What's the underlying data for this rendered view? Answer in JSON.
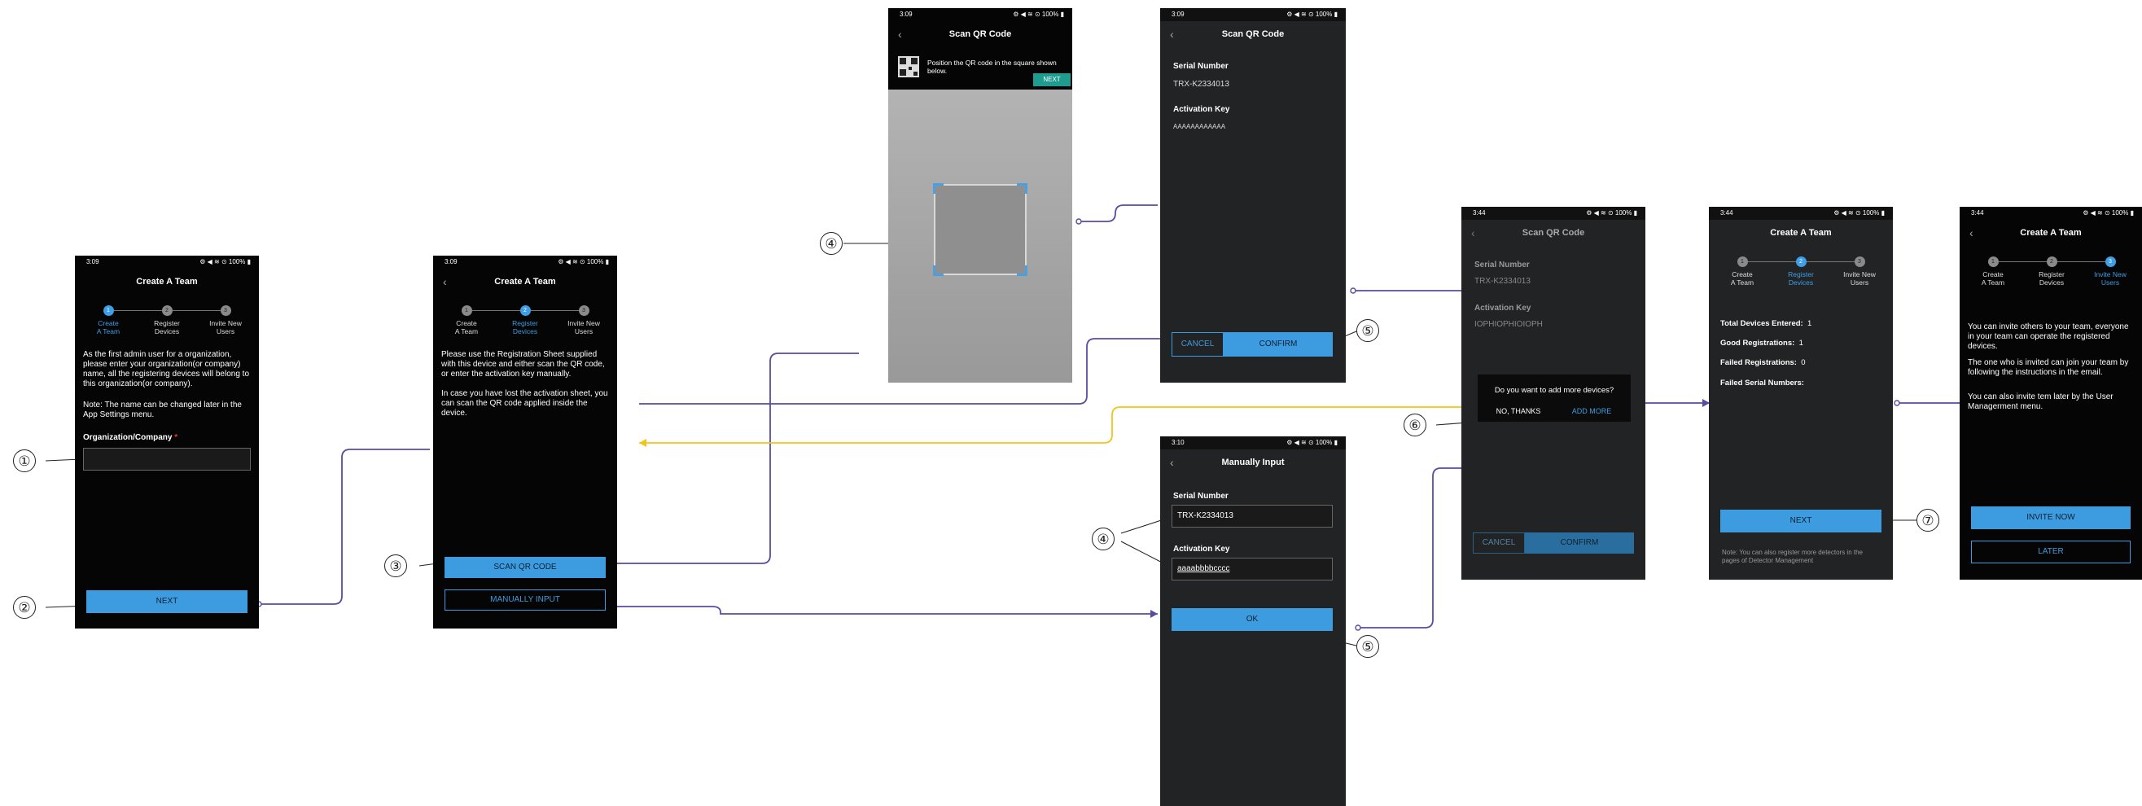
{
  "status_times": {
    "s1": "3:09",
    "s2": "3:09",
    "s3": "3:09",
    "s4": "3:09",
    "s5": "3:10",
    "s6": "3:44",
    "s7": "3:44",
    "s8": "3:44"
  },
  "status_icons": "⚙ ◀ ≋ ⊙ 100% ▮",
  "back_glyph": "‹",
  "stepper": {
    "step1": {
      "num": "1",
      "line1": "Create",
      "line2": "A Team"
    },
    "step2": {
      "num": "2",
      "line1": "Register",
      "line2": "Devices"
    },
    "step3": {
      "num": "3",
      "line1": "Invite New",
      "line2": "Users"
    }
  },
  "create_team": {
    "title": "Create A Team",
    "desc": "As the first admin user for a organization, please enter your organization(or company) name, all the registering devices will belong to this organization(or company).",
    "note": "Note: The name can be changed later in the App Settings menu.",
    "field_label": "Organization/Company",
    "required_mark": "*",
    "next": "NEXT"
  },
  "register_devices": {
    "title": "Create A Team",
    "desc1": "Please use the Registration Sheet supplied with this device and either scan the QR code, or enter the activation key manually.",
    "desc2": "In case you have lost the activation sheet, you can scan the QR code applied inside the device.",
    "scan": "SCAN QR CODE",
    "manual": "MANUALLY INPUT"
  },
  "scan_camera": {
    "title": "Scan QR Code",
    "hint": "Position the QR code in the square shown below.",
    "next": "NEXT"
  },
  "scan_result": {
    "title": "Scan QR Code",
    "serial_label": "Serial Number",
    "serial": "TRX-K2334013",
    "key_label": "Activation Key",
    "key": "AAAAAAAAAAAA",
    "cancel": "CANCEL",
    "confirm": "CONFIRM"
  },
  "manual_input": {
    "title": "Manually Input",
    "serial_label": "Serial Number",
    "serial": "TRX-K2334013",
    "key_label": "Activation Key",
    "key": "aaaabbbbcccc",
    "ok": "OK"
  },
  "add_more": {
    "title": "Scan QR Code",
    "serial_label": "Serial Number",
    "serial": "TRX-K2334013",
    "key_label": "Activation Key",
    "key": "IOPHIOPHIOIOPH",
    "question": "Do you want to add more devices?",
    "no": "NO, THANKS",
    "add": "ADD MORE",
    "cancel": "CANCEL",
    "confirm": "CONFIRM"
  },
  "summary": {
    "title": "Create A Team",
    "total_label": "Total Devices Entered:",
    "total": "1",
    "good_label": "Good Registrations:",
    "good": "1",
    "failed_label": "Failed Registrations:",
    "failed": "0",
    "failed_serials_label": "Failed Serial Numbers:",
    "next": "NEXT",
    "note": "Note: You can also register more detectors in the pages of Detector Management"
  },
  "invite": {
    "title": "Create A Team",
    "p1": "You can invite others to your team, everyone in your team can operate the registered devices.",
    "p2": "The one who is invited can join your team by following the instructions in the email.",
    "p3": "You can also invite tem later by the User Managerment menu.",
    "invite_now": "INVITE NOW",
    "later": "LATER"
  },
  "callouts": {
    "c1": "①",
    "c2": "②",
    "c3": "③",
    "c4": "④",
    "c5": "⑤",
    "c6": "⑥",
    "c7": "⑦"
  },
  "colors": {
    "flow_line": "#5b4aa3",
    "back_line": "#f2c418",
    "accent": "#3d9ce0",
    "screen_bg": "#050505",
    "panel_bg": "#222324"
  }
}
